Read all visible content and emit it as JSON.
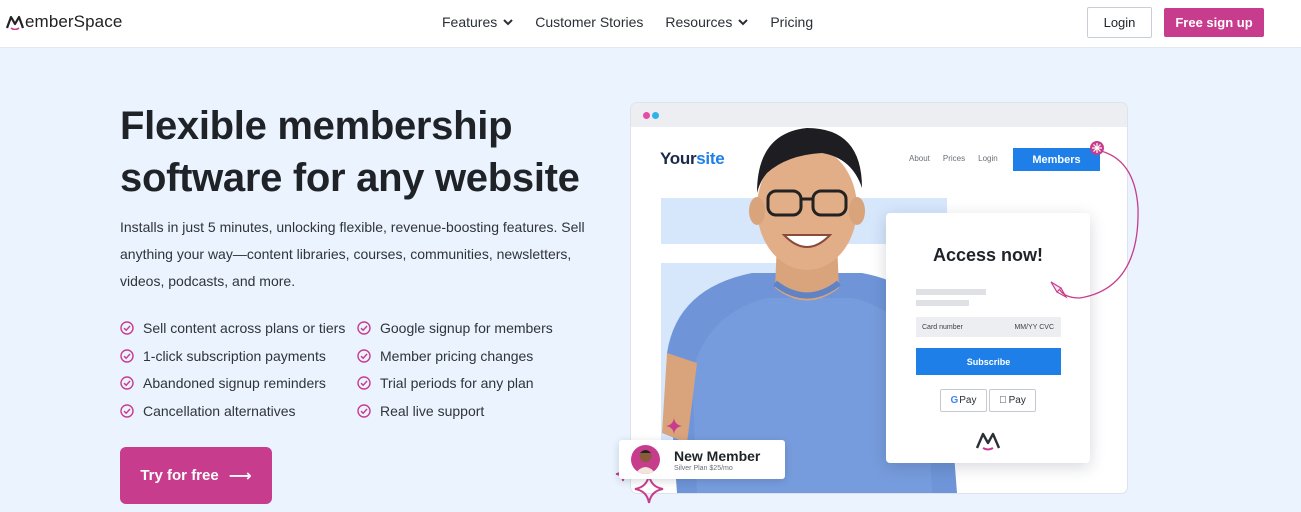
{
  "nav": {
    "logo": "MemberSpace",
    "links": [
      {
        "label": "Features",
        "has_dropdown": true
      },
      {
        "label": "Customer Stories",
        "has_dropdown": false
      },
      {
        "label": "Resources",
        "has_dropdown": true
      },
      {
        "label": "Pricing",
        "has_dropdown": false
      }
    ],
    "login_label": "Login",
    "signup_label": "Free sign up"
  },
  "hero": {
    "title_line1": "Flexible membership",
    "title_line2": "software for any website",
    "description": "Installs in just 5 minutes, unlocking flexible, revenue-boosting features. Sell anything your way—content libraries, courses, communities, newsletters, videos, podcasts, and more.",
    "features": [
      "Sell content across plans or tiers",
      "Google signup for members",
      "1-click subscription payments",
      "Member pricing changes",
      "Abandoned signup reminders",
      "Trial periods for any plan",
      "Cancellation alternatives",
      "Real live support"
    ],
    "cta_label": "Try for free",
    "cta_arrow": "⟶"
  },
  "mockup": {
    "site_logo_a": "Your",
    "site_logo_b": "site",
    "site_nav": [
      "About",
      "Prices",
      "Login"
    ],
    "members_button": "Members",
    "access_title": "Access now!",
    "card_number_label": "Card number",
    "card_expiry_label": "MM/YY CVC",
    "subscribe_label": "Subscribe",
    "gpay_label": "Pay",
    "applepay_label": "Pay",
    "toast_title": "New Member",
    "toast_subtitle": "Silver Plan $25/mo"
  },
  "colors": {
    "brand_pink": "#c83c8d",
    "accent_blue": "#1e7fe8",
    "hero_bg": "#eaf3fe"
  }
}
